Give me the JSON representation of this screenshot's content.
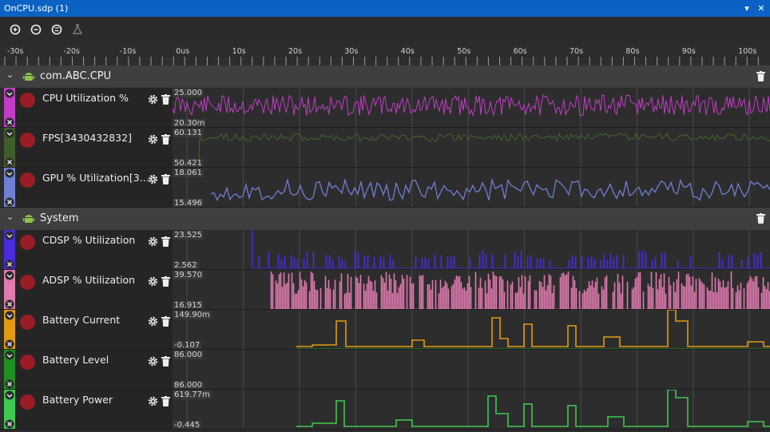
{
  "window": {
    "title": "OnCPU.sdp (1)",
    "pin_glyph": "▾",
    "close_glyph": "✕"
  },
  "toolbar": {
    "icons": [
      "zoom-in-icon",
      "zoom-out-icon",
      "zoom-reset-icon",
      "flask-icon"
    ]
  },
  "ruler": {
    "labels": [
      "-30s",
      "-20s",
      "-10s",
      "0us",
      "10s",
      "20s",
      "30s",
      "40s",
      "50s",
      "60s",
      "70s",
      "80s",
      "90s",
      "100s"
    ]
  },
  "groups": [
    {
      "name": "com.ABC.CPU",
      "tracks": [
        {
          "name": "CPU Utilization %",
          "ymax": "25.000",
          "ymin": "20.30m",
          "color": "#c23cc7"
        },
        {
          "name": "FPS[3430432832]",
          "ymax": "60.131",
          "ymin": "50.421",
          "color": "#3f5e2a"
        },
        {
          "name": "GPU % Utilization[3…",
          "ymax": "18.061",
          "ymin": "15.496",
          "color": "#6f7fd6"
        }
      ]
    },
    {
      "name": "System",
      "tracks": [
        {
          "name": "CDSP % Utilization",
          "ymax": "23.525",
          "ymin": "2.562",
          "color": "#4a2be0"
        },
        {
          "name": "ADSP % Utilization",
          "ymax": "39.570",
          "ymin": "16.915",
          "color": "#e07ab0"
        },
        {
          "name": "Battery Current",
          "ymax": "149.90m",
          "ymin": "-0.107",
          "color": "#e39a12"
        },
        {
          "name": "Battery Level",
          "ymax": "86.000",
          "ymin": "86.000",
          "color": "#1f8f1f"
        },
        {
          "name": "Battery Power",
          "ymax": "619.77m",
          "ymin": "-0.445",
          "color": "#3ec94f"
        }
      ]
    }
  ],
  "colors": {
    "titlebar": "#0a63c2",
    "group_header": "#3f3f3f",
    "record_dot": "#9a1c24",
    "grid": "#4a4a4a"
  }
}
